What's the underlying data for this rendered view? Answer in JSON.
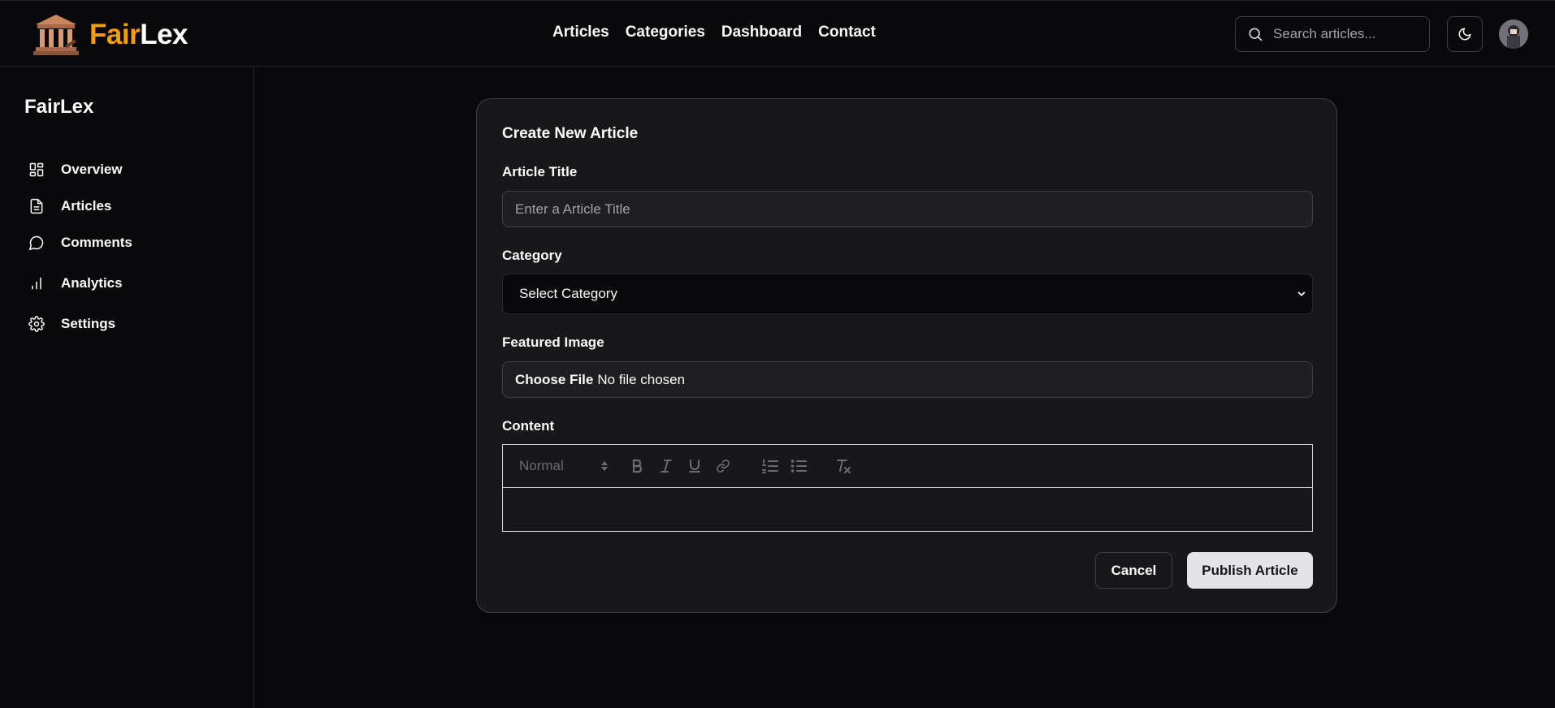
{
  "brand": {
    "part1": "Fair",
    "part2": "Lex",
    "accent": "#f59e0b"
  },
  "nav": {
    "items": [
      "Articles",
      "Categories",
      "Dashboard",
      "Contact"
    ]
  },
  "search": {
    "placeholder": "Search articles...",
    "icon": "search-icon"
  },
  "header_icons": {
    "theme": "moon-icon",
    "avatar": "user-avatar"
  },
  "sidebar": {
    "title": "FairLex",
    "items": [
      {
        "label": "Overview",
        "icon": "grid-icon"
      },
      {
        "label": "Articles",
        "icon": "file-text-icon"
      },
      {
        "label": "Comments",
        "icon": "message-circle-icon"
      },
      {
        "label": "Analytics",
        "icon": "bar-chart-icon"
      },
      {
        "label": "Settings",
        "icon": "gear-icon"
      }
    ]
  },
  "form": {
    "title": "Create New Article",
    "article_title_label": "Article Title",
    "article_title_placeholder": "Enter a Article Title",
    "category_label": "Category",
    "category_value": "Select Category",
    "image_label": "Featured Image",
    "file_button": "Choose File",
    "file_status": "No file chosen",
    "content_label": "Content",
    "editor_format": "Normal",
    "cancel": "Cancel",
    "publish": "Publish Article"
  },
  "colors": {
    "background": "#09090b",
    "card": "#18181b",
    "border": "#3f3f46",
    "publish_bg": "#e4e4e7"
  }
}
